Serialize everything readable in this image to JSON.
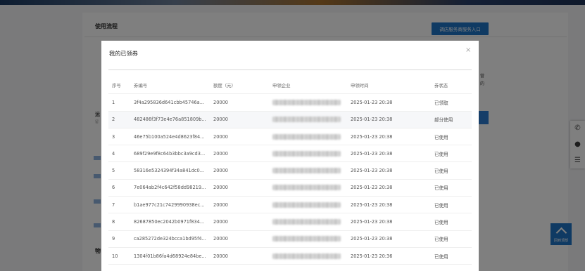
{
  "page": {
    "heading": "使用流程",
    "entry_button": "调店服务商服务入口",
    "bottom_heading": "物",
    "side_text_1": "运",
    "side_text_2": "留",
    "right_text_1": "营",
    "right_text_2": "的"
  },
  "modal": {
    "title": "我的已领券",
    "close": "×",
    "columns": [
      "序号",
      "券编号",
      "额度（元）",
      "申领企业",
      "申领时间",
      "券状态"
    ],
    "rows": [
      {
        "no": "1",
        "code": "3f4a295836d641cbb45746a...",
        "amount": "20000",
        "company": "",
        "time": "2025-01-23 20:38",
        "status": "已领取"
      },
      {
        "no": "2",
        "code": "482486f3f73e4e76a851809b...",
        "amount": "20000",
        "company": "",
        "time": "2025-01-23 20:38",
        "status": "部分使用"
      },
      {
        "no": "3",
        "code": "46e75b100a524e4d8623f84...",
        "amount": "20000",
        "company": "",
        "time": "2025-01-23 20:38",
        "status": "已使用"
      },
      {
        "no": "4",
        "code": "689f29e9f8c64b3bbc3a9cd3...",
        "amount": "20000",
        "company": "",
        "time": "2025-01-23 20:38",
        "status": "已使用"
      },
      {
        "no": "5",
        "code": "58316e5324394f34a841dc0...",
        "amount": "20000",
        "company": "",
        "time": "2025-01-23 20:38",
        "status": "已使用"
      },
      {
        "no": "6",
        "code": "7e064ab2f4c642f58dd98219...",
        "amount": "20000",
        "company": "",
        "time": "2025-01-23 20:38",
        "status": "已使用"
      },
      {
        "no": "7",
        "code": "b1ae977c21c7429990938ec...",
        "amount": "20000",
        "company": "",
        "time": "2025-01-23 20:38",
        "status": "已使用"
      },
      {
        "no": "8",
        "code": "82687850ec2042b0971f834...",
        "amount": "20000",
        "company": "",
        "time": "2025-01-23 20:38",
        "status": "已使用"
      },
      {
        "no": "9",
        "code": "ca285272de324bcca1bd95f4...",
        "amount": "20000",
        "company": "",
        "time": "2025-01-23 20:38",
        "status": "已使用"
      },
      {
        "no": "10",
        "code": "1304f01b86fa4d68924e84be...",
        "amount": "20000",
        "company": "",
        "time": "2025-01-23 20:36",
        "status": "已使用"
      }
    ]
  },
  "side_widget": {
    "phone_icon": "phone-icon",
    "chat_icon": "wechat-icon",
    "list_icon": "list-icon"
  },
  "back_to_top": {
    "label": "回到顶部"
  },
  "colors": {
    "primary": "#1e74c6",
    "overlay": "rgba(0,0,0,0.5)"
  }
}
